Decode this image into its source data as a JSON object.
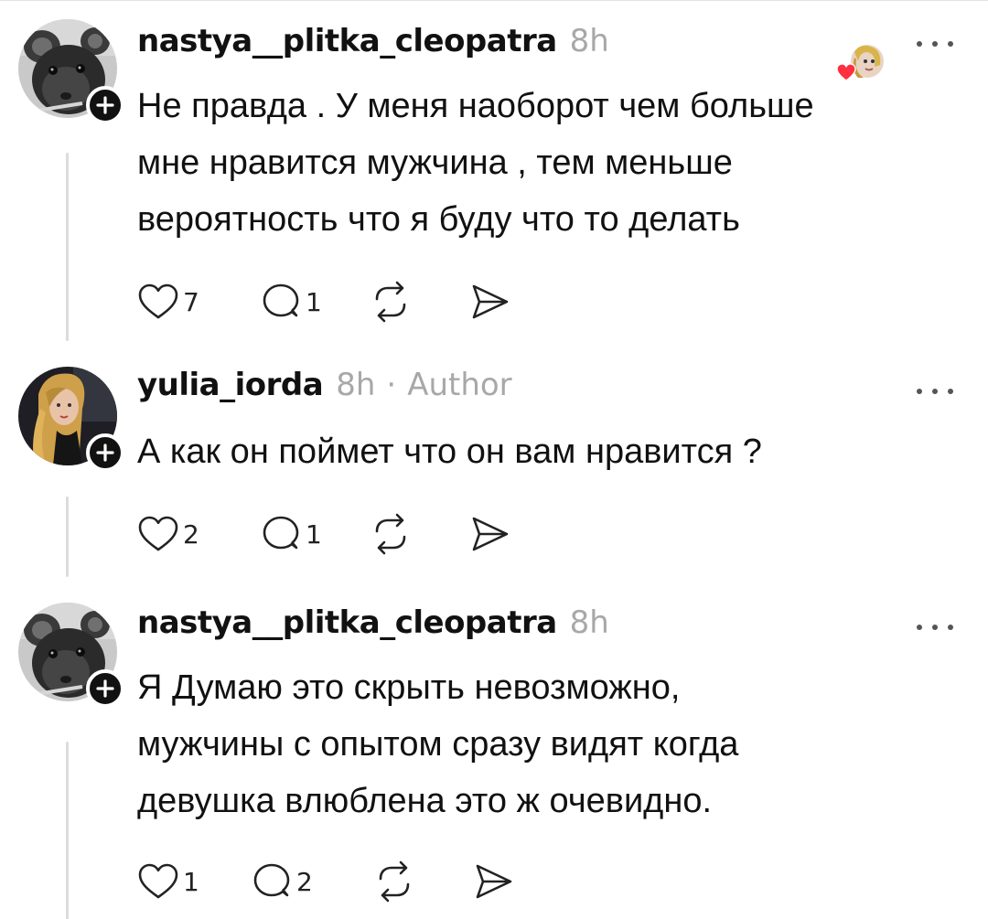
{
  "comments": [
    {
      "username": "nastya__plitka_cleopatra",
      "time": "8h",
      "is_author": false,
      "author_label": "",
      "liked_by_author": true,
      "text_lines": [
        "Не правда . У меня наоборот чем больше",
        "мне нравится мужчина , тем меньше",
        "вероятность что я буду что то делать"
      ],
      "likes": "7",
      "replies": "1",
      "avatar": "rat-avatar"
    },
    {
      "username": "yulia_iorda",
      "time": "8h",
      "is_author": true,
      "author_label": "Author",
      "separator": "·",
      "liked_by_author": false,
      "text_lines": [
        "А как он поймет что он вам нравится ?"
      ],
      "likes": "2",
      "replies": "1",
      "avatar": "woman-portrait-avatar"
    },
    {
      "username": "nastya__plitka_cleopatra",
      "time": "8h",
      "is_author": false,
      "author_label": "",
      "liked_by_author": false,
      "text_lines": [
        "Я Думаю это скрыть невозможно,",
        "мужчины с опытом сразу видят когда",
        "девушка влюблена это ж очевидно."
      ],
      "likes": "1",
      "replies": "2",
      "avatar": "rat-avatar"
    }
  ],
  "icons": {
    "like": "heart-outline-icon",
    "reply": "speech-bubble-icon",
    "repost": "repost-arrows-icon",
    "share": "send-arrow-icon",
    "more": "more-dots-icon",
    "follow": "plus-icon",
    "liked_heart": "red-heart-icon"
  },
  "colors": {
    "text": "#111111",
    "muted": "#a8a8a8",
    "thread_line": "#dcdcdc",
    "heart_red": "#ff3040"
  }
}
